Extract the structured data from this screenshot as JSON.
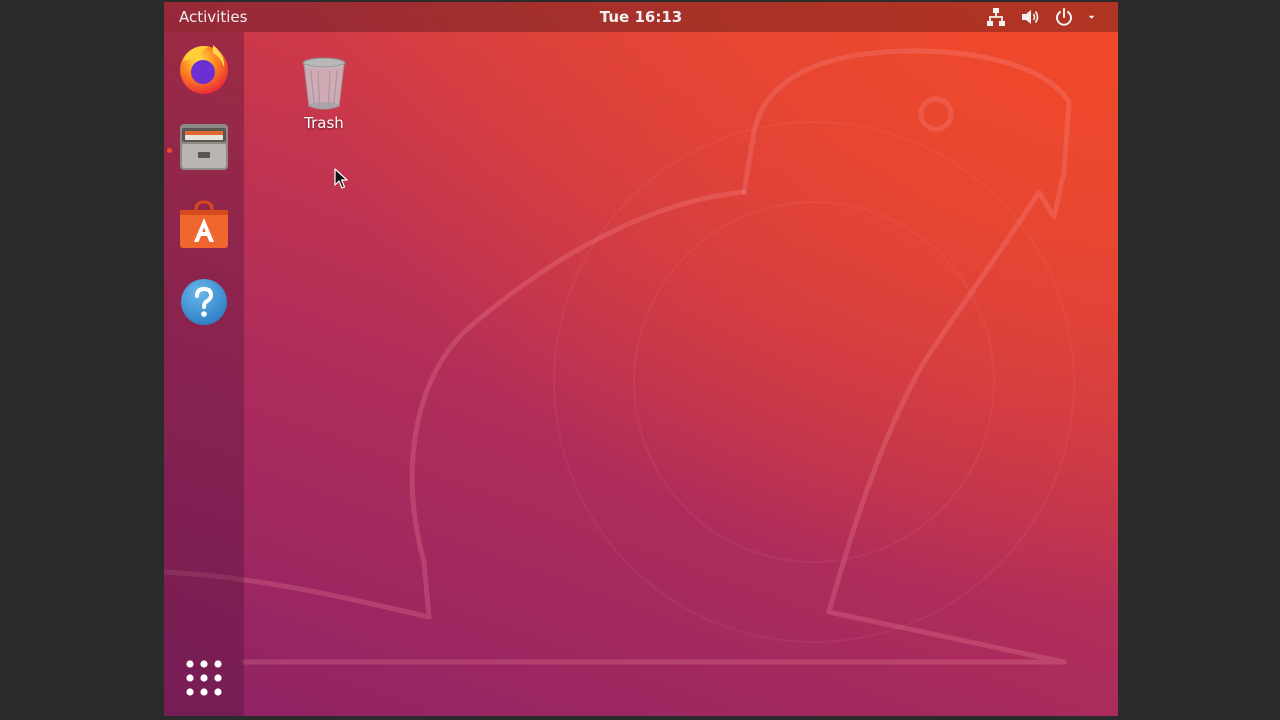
{
  "topbar": {
    "activities_label": "Activities",
    "clock": "Tue 16:13",
    "tray_icons": [
      "network-icon",
      "volume-icon",
      "power-icon",
      "chevron-down-icon"
    ]
  },
  "dock": {
    "apps": [
      {
        "name": "firefox",
        "icon": "firefox-icon"
      },
      {
        "name": "files",
        "icon": "files-icon",
        "running": true
      },
      {
        "name": "software",
        "icon": "software-center-icon"
      },
      {
        "name": "help",
        "icon": "help-icon"
      }
    ],
    "show_apps_icon": "app-grid-icon"
  },
  "desktop": {
    "icons": [
      {
        "label": "Trash",
        "icon": "trash-icon"
      }
    ]
  },
  "colors": {
    "accent": "#E95420",
    "wallpaper_top": "#E84A30",
    "wallpaper_bottom": "#8E2266",
    "running_indicator": "#F04A2A"
  }
}
